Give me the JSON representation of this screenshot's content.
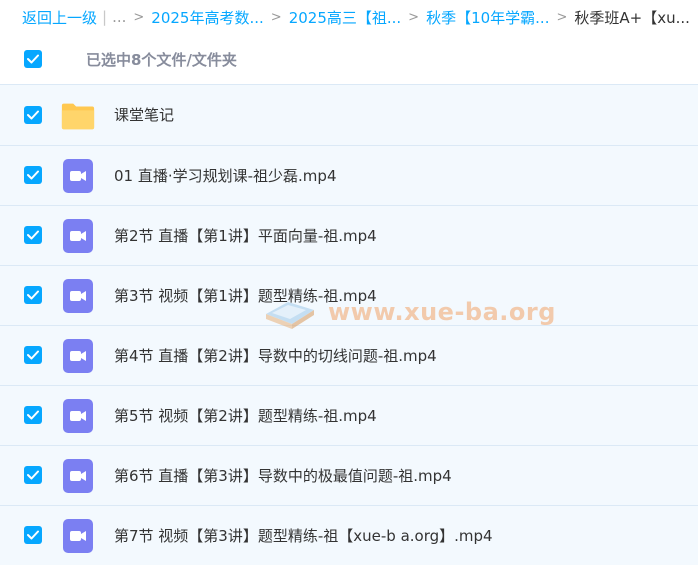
{
  "breadcrumb": {
    "back_label": "返回上一级",
    "pipe": "|",
    "ellipsis": "...",
    "separator": ">",
    "items": [
      {
        "label": "2025年高考数..."
      },
      {
        "label": "2025高三【祖..."
      },
      {
        "label": "秋季【10年学霸..."
      },
      {
        "label": "秋季班A+【xu..."
      }
    ]
  },
  "selection": {
    "checked": true,
    "label": "已选中8个文件/文件夹"
  },
  "files": [
    {
      "type": "folder",
      "name": "课堂笔记",
      "checked": true,
      "icon": "folder-icon"
    },
    {
      "type": "video",
      "name": "01 直播·学习规划课-祖少磊.mp4",
      "checked": true,
      "icon": "video-file-icon"
    },
    {
      "type": "video",
      "name": "第2节 直播【第1讲】平面向量-祖.mp4",
      "checked": true,
      "icon": "video-file-icon"
    },
    {
      "type": "video",
      "name": "第3节 视频【第1讲】题型精练-祖.mp4",
      "checked": true,
      "icon": "video-file-icon"
    },
    {
      "type": "video",
      "name": "第4节 直播【第2讲】导数中的切线问题-祖.mp4",
      "checked": true,
      "icon": "video-file-icon"
    },
    {
      "type": "video",
      "name": "第5节 视频【第2讲】题型精练-祖.mp4",
      "checked": true,
      "icon": "video-file-icon"
    },
    {
      "type": "video",
      "name": "第6节 直播【第3讲】导数中的极最值问题-祖.mp4",
      "checked": true,
      "icon": "video-file-icon"
    },
    {
      "type": "video",
      "name": "第7节 视频【第3讲】题型精练-祖【xue-b a.org】.mp4",
      "checked": true,
      "icon": "video-file-icon"
    }
  ],
  "watermark": {
    "text": "www.xue-ba.org"
  },
  "colors": {
    "accent": "#06a7ff",
    "row_background": "#f3f9fe",
    "row_border": "#dbe9f6",
    "folder": "#ffc850",
    "video_icon": "#7b7ff2",
    "watermark": "#f2a46a"
  }
}
